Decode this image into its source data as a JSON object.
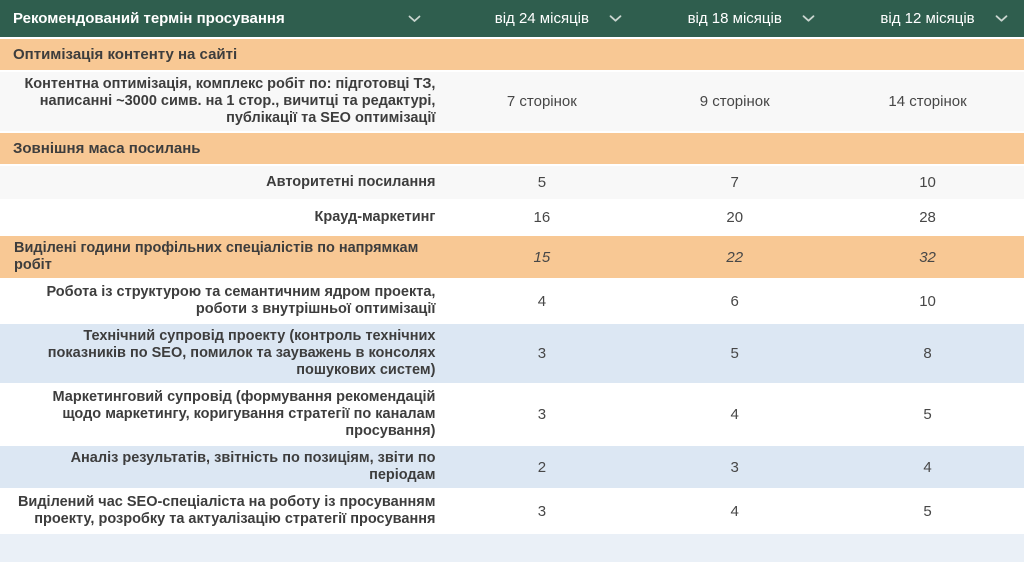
{
  "table": {
    "header": {
      "title": "Рекомендований термін просування",
      "columns": [
        "від 24 місяців",
        "від 18 місяців",
        "від 12 місяців"
      ],
      "dropdown_icon": "chevron-down"
    },
    "rows": [
      {
        "type": "section",
        "label": "Оптимізація контенту на сайті"
      },
      {
        "type": "data",
        "bg": "gray",
        "label": "Контентна оптимізація, комплекс робіт по: підготовці ТЗ, написанні ~3000 симв. на 1 стор., вичитці та редактурі, публікації та SEO оптимізації",
        "values": [
          "7 сторінок",
          "9 сторінок",
          "14 сторінок"
        ]
      },
      {
        "type": "section",
        "label": "Зовнішня маса посилань"
      },
      {
        "type": "data",
        "bg": "gray",
        "label": "Авторитетні посилання",
        "values": [
          "5",
          "7",
          "10"
        ]
      },
      {
        "type": "data",
        "bg": "white",
        "label": "Крауд-маркетинг",
        "values": [
          "16",
          "20",
          "28"
        ]
      },
      {
        "type": "data",
        "bg": "orange",
        "align": "left",
        "italic_values": true,
        "label": "Виділені години профільних спеціалістів по напрямкам робіт",
        "values": [
          "15",
          "22",
          "32"
        ]
      },
      {
        "type": "data",
        "bg": "white",
        "label": "Робота із структурою та семантичним ядром проекта, роботи з внутрішньої оптимізації",
        "values": [
          "4",
          "6",
          "10"
        ]
      },
      {
        "type": "data",
        "bg": "blue",
        "label": "Технічний супровід проекту (контроль технічних показників по SEO,  помилок та зауважень в консолях пошукових систем)",
        "values": [
          "3",
          "5",
          "8"
        ]
      },
      {
        "type": "data",
        "bg": "white",
        "label": "Маркетинговий супровід (формування рекомендацій щодо маркетингу, коригування стратегії по каналам просування)",
        "values": [
          "3",
          "4",
          "5"
        ]
      },
      {
        "type": "data",
        "bg": "blue",
        "label": "Аналіз результатів, звітність по позиціям, звіти по періодам",
        "values": [
          "2",
          "3",
          "4"
        ]
      },
      {
        "type": "data",
        "bg": "white",
        "label": "Виділений час SEO-спеціаліста на роботу із просуванням проекту, розробку та актуалізацію стратегії просування",
        "values": [
          "3",
          "4",
          "5"
        ]
      },
      {
        "type": "partial_row"
      }
    ],
    "colors": {
      "header_bg": "#2f5e4e",
      "header_text": "#ffffff",
      "chevron": "#c9d5cf",
      "section_bg": "#f8c894",
      "row_gray": "#f8f8f8",
      "row_blue": "#dce7f3",
      "row_white": "#ffffff",
      "label_text": "#3d3d3d",
      "value_text": "#474747"
    }
  }
}
